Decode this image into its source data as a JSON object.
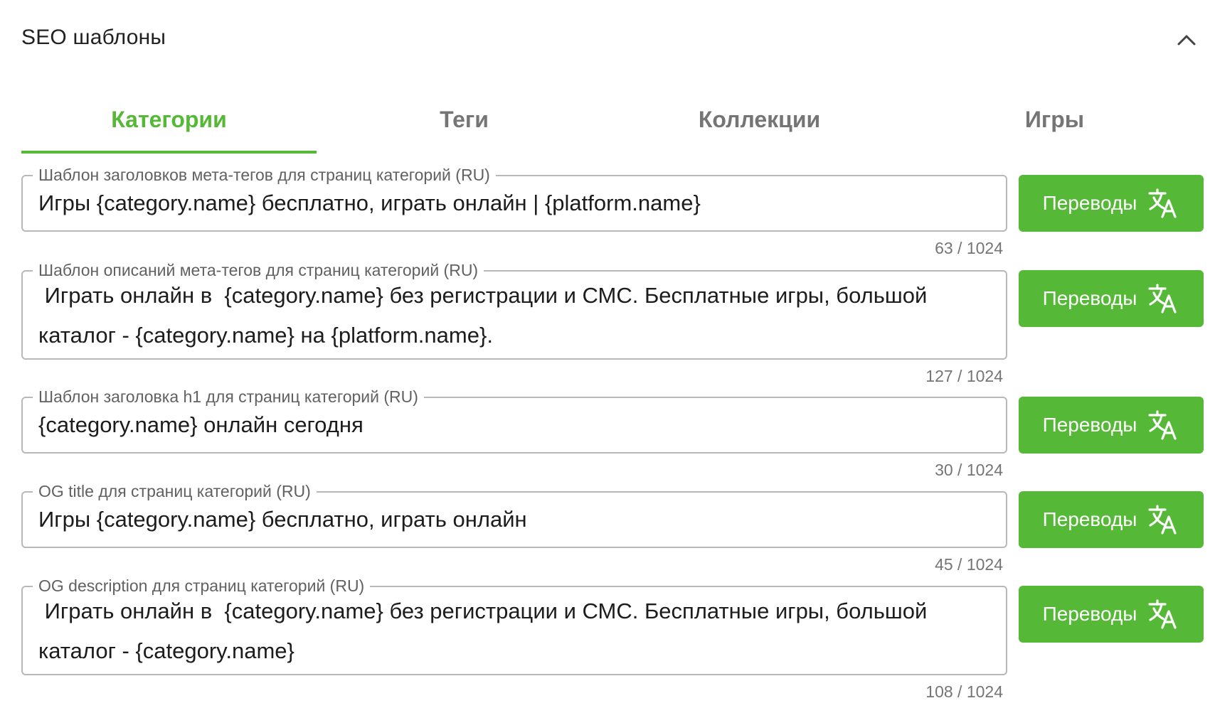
{
  "header": {
    "title": "SEO шаблоны",
    "toggle_icon": "chevron-up-icon"
  },
  "tabs": [
    {
      "label": "Категории",
      "active": true
    },
    {
      "label": "Теги",
      "active": false
    },
    {
      "label": "Коллекции",
      "active": false
    },
    {
      "label": "Игры",
      "active": false
    }
  ],
  "accent_color": "#55b937",
  "translate_label": "Переводы",
  "translate_icon": "translate-icon",
  "fields": [
    {
      "label": "Шаблон заголовков мета-тегов для страниц категорий (RU)",
      "value": "Игры {category.name} бесплатно, играть онлайн | {platform.name}",
      "counter": "63 / 1024"
    },
    {
      "label": "Шаблон описаний мета-тегов для страниц категорий (RU)",
      "value": " Играть онлайн в  {category.name} без регистрации и СМС. Бесплатные игры, большой каталог - {category.name} на {platform.name}.",
      "counter": "127 / 1024"
    },
    {
      "label": "Шаблон заголовка h1 для страниц категорий (RU)",
      "value": "{category.name} онлайн сегодня",
      "counter": "30 / 1024"
    },
    {
      "label": "OG title для страниц категорий (RU)",
      "value": "Игры {category.name} бесплатно, играть онлайн",
      "counter": "45 / 1024"
    },
    {
      "label": "OG description для страниц категорий (RU)",
      "value": " Играть онлайн в  {category.name} без регистрации и СМС. Бесплатные игры, большой каталог - {category.name}",
      "counter": "108 / 1024"
    }
  ]
}
